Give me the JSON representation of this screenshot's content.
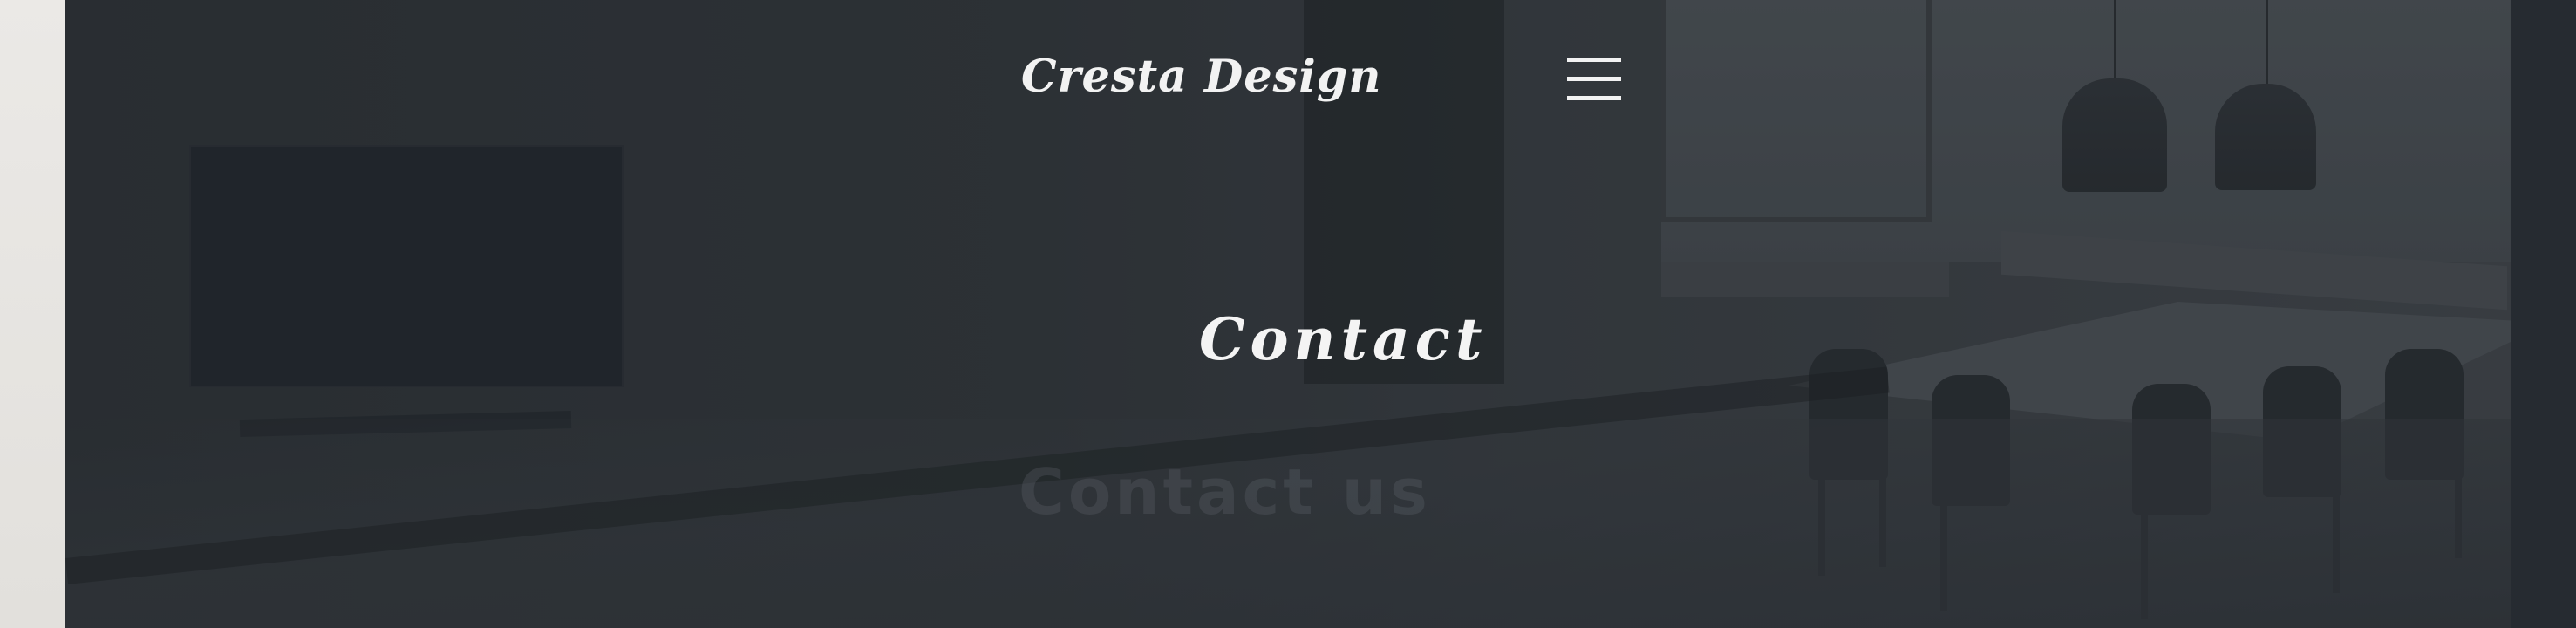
{
  "header": {
    "site_title": "Cresta Design",
    "menu_icon": "hamburger-menu-icon"
  },
  "hero": {
    "heading": "Contact",
    "subheading": "Contact us"
  },
  "colors": {
    "text": "#f2f2f2",
    "overlay": "#303439",
    "side_strip_left": "#e8e6e3",
    "side_strip_right": "#262b31"
  }
}
